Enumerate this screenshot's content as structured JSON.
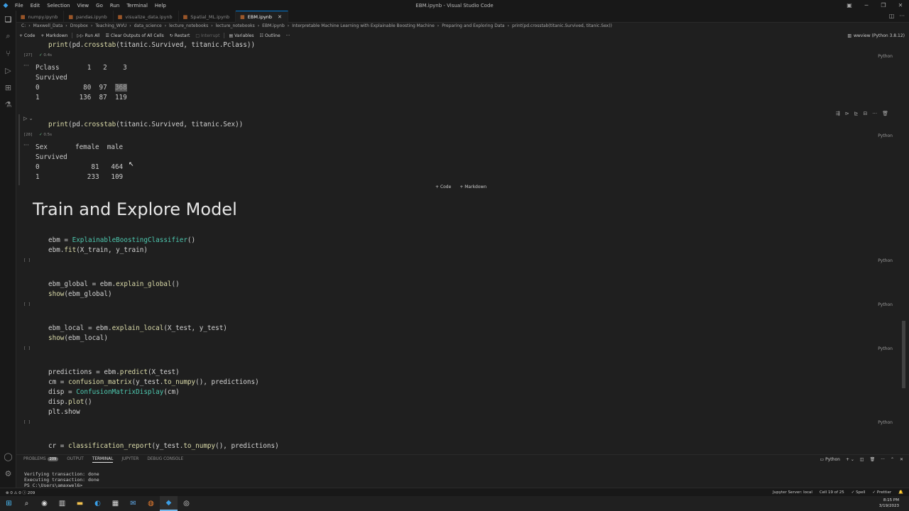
{
  "titlebar": {
    "menu": [
      "File",
      "Edit",
      "Selection",
      "View",
      "Go",
      "Run",
      "Terminal",
      "Help"
    ],
    "window_title": "EBM.ipynb - Visual Studio Code"
  },
  "tabs": [
    {
      "label": "numpy.ipynb",
      "active": false
    },
    {
      "label": "pandas.ipynb",
      "active": false
    },
    {
      "label": "visualize_data.ipynb",
      "active": false
    },
    {
      "label": "Spatial_ML.ipynb",
      "active": false
    },
    {
      "label": "EBM.ipynb",
      "active": true
    }
  ],
  "breadcrumb": [
    "C:",
    "Maxwell_Data",
    "Dropbox",
    "Teaching_WVU",
    "data_science",
    "lecture_notebooks",
    "lecture_notebooks",
    "EBM.ipynb",
    "Interpretable Machine Learning with Explainable Boosting Machine",
    "Preparing and Exploring Data",
    "print(pd.crosstab(titanic.Survived, titanic.Sex))"
  ],
  "toolbar": {
    "code": "Code",
    "markdown": "Markdown",
    "run_all": "Run All",
    "clear_outputs": "Clear Outputs of All Cells",
    "restart": "Restart",
    "interrupt": "Interrupt",
    "variables": "Variables",
    "outline": "Outline",
    "more": "···"
  },
  "kernel": "wwview (Python 3.8.12)",
  "cells": {
    "c1": {
      "exec": "[27]",
      "timing": "0.4s",
      "lang": "Python",
      "output": "Pclass       1   2    3\nSurvived              \n0           80  97  ",
      "output_highlight": "368",
      "output_tail": "\n1          136  87  119"
    },
    "c2": {
      "exec": "[28]",
      "timing": "0.5s",
      "lang": "Python",
      "output": "Sex       female  male\nSurvived              \n0             81   464\n1            233   109"
    },
    "add_code": "Code",
    "add_markdown": "Markdown",
    "heading": "Train and Explore Model",
    "c3": {
      "exec": "[ ]",
      "lang": "Python"
    },
    "c4": {
      "exec": "[ ]",
      "lang": "Python"
    },
    "c5": {
      "exec": "[ ]",
      "lang": "Python"
    },
    "c6": {
      "exec": "[ ]",
      "lang": "Python"
    }
  },
  "code_tokens": {
    "c1": [
      "print",
      "(pd.",
      "crosstab",
      "(titanic.Survived, titanic.",
      "Pclass",
      "))"
    ],
    "c2": [
      "print",
      "(pd.",
      "crosstab",
      "(titanic.Survived, titanic.Sex))"
    ],
    "c3a": [
      "ebm = ",
      "ExplainableBoostingClassifier",
      "()"
    ],
    "c3b": [
      "ebm.",
      "fit",
      "(X_train, y_train)"
    ],
    "c4a": [
      "ebm_global = ebm.",
      "explain_global",
      "()"
    ],
    "c4b": [
      "show",
      "(ebm_global)"
    ],
    "c5a": [
      "ebm_local = ebm.",
      "explain_local",
      "(X_test, y_test)"
    ],
    "c5b": [
      "show",
      "(ebm_local)"
    ],
    "c6a": [
      "predictions = ebm.",
      "predict",
      "(X_test)"
    ],
    "c6b": [
      "cm = ",
      "confusion_matrix",
      "(y_test.",
      "to_numpy",
      "(), predictions)"
    ],
    "c6c": [
      "disp = ",
      "ConfusionMatrixDisplay",
      "(cm)"
    ],
    "c6d": [
      "disp.",
      "plot",
      "()"
    ],
    "c6e": [
      "plt.show"
    ],
    "c7a": [
      "cr = ",
      "classification_report",
      "(y_test.",
      "to_numpy",
      "(), predictions)"
    ]
  },
  "panel": {
    "tabs": [
      "PROBLEMS",
      "OUTPUT",
      "TERMINAL",
      "JUPYTER",
      "DEBUG CONSOLE"
    ],
    "problems_count": "209",
    "active_tab": "TERMINAL",
    "shell": "Python",
    "terminal_text": "Verifying transaction: done\nExecuting transaction: done\nPS C:\\Users\\amaxwel6>"
  },
  "statusbar": {
    "left": "⊗ 0 ⚠ 0 ⓘ 209",
    "server": "Jupyter Server: local",
    "cell": "Cell 19 of 25",
    "spell": "✓ Spell",
    "prettier": "✓ Prettier"
  },
  "taskbar": {
    "time": "8:15 PM",
    "date": "3/19/2023"
  }
}
